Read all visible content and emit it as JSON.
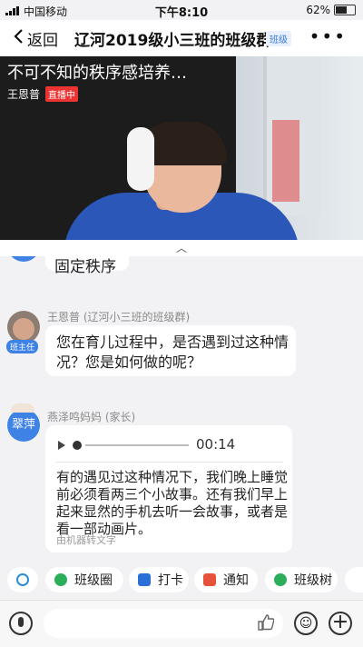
{
  "status_bar": {
    "carrier": "中国移动",
    "time": "下午8:10",
    "battery": "62%"
  },
  "nav": {
    "back_label": "返回",
    "title": "辽河2019级小三班的班级群",
    "badge": "班级",
    "more": "•••"
  },
  "video": {
    "overlay_title": "不可不知的秩序感培养…",
    "host": "王恩普",
    "live_tag": "直播中"
  },
  "chat": {
    "previous_message": "固定秩序",
    "messages": [
      {
        "sender": "王恩普 (辽河小三班的班级群)",
        "role_tag": "班主任",
        "text": "您在育儿过程中，是否遇到过这种情况？您是如何做的呢？"
      },
      {
        "sender": "燕泽鸣妈妈 (家长)",
        "avatar_text": "翠萍",
        "duration": "00:14",
        "transcript": "有的遇见过这种情况下，我们晚上睡觉前必须看两三个小故事。还有我们早上起来显然的手机去听一会故事，或者是看一部动画片。",
        "transcript_note": "由机器转文字"
      }
    ]
  },
  "quick_actions": [
    {
      "label": "",
      "icon": "headset-icon"
    },
    {
      "label": "班级圈",
      "icon": "circle-icon"
    },
    {
      "label": "打卡",
      "icon": "checkin-icon"
    },
    {
      "label": "通知",
      "icon": "megaphone-icon"
    },
    {
      "label": "班级树",
      "icon": "tree-icon"
    }
  ],
  "colors": {
    "accent": "#3f82e6",
    "live": "#e33333"
  }
}
